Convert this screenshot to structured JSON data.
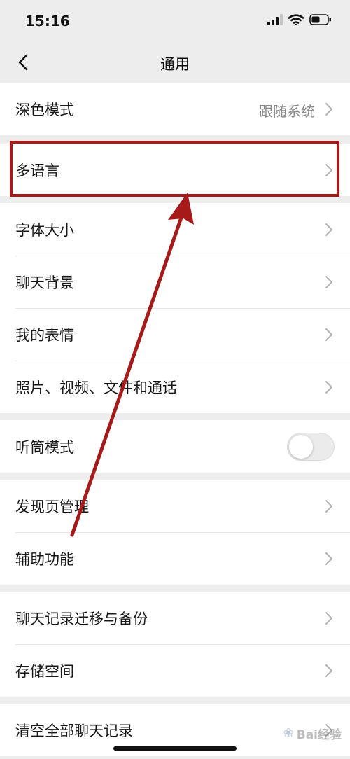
{
  "status_bar": {
    "time": "15:16"
  },
  "nav": {
    "title": "通用"
  },
  "groups": [
    {
      "rows": [
        {
          "label": "深色模式",
          "value": "跟随系统"
        }
      ]
    },
    {
      "rows": [
        {
          "label": "多语言"
        }
      ]
    },
    {
      "rows": [
        {
          "label": "字体大小"
        },
        {
          "label": "聊天背景"
        },
        {
          "label": "我的表情"
        },
        {
          "label": "照片、视频、文件和通话"
        }
      ]
    },
    {
      "rows": [
        {
          "label": "听筒模式",
          "toggle": false
        }
      ]
    },
    {
      "rows": [
        {
          "label": "发现页管理"
        },
        {
          "label": "辅助功能"
        }
      ]
    },
    {
      "rows": [
        {
          "label": "聊天记录迁移与备份"
        },
        {
          "label": "存储空间"
        }
      ]
    },
    {
      "rows": [
        {
          "label": "清空全部聊天记录"
        }
      ]
    }
  ],
  "watermark": {
    "text": "Bai经验"
  },
  "colors": {
    "background": "#ededed",
    "annotation": "#a61a1a",
    "chevron": "#b2b2b2"
  }
}
